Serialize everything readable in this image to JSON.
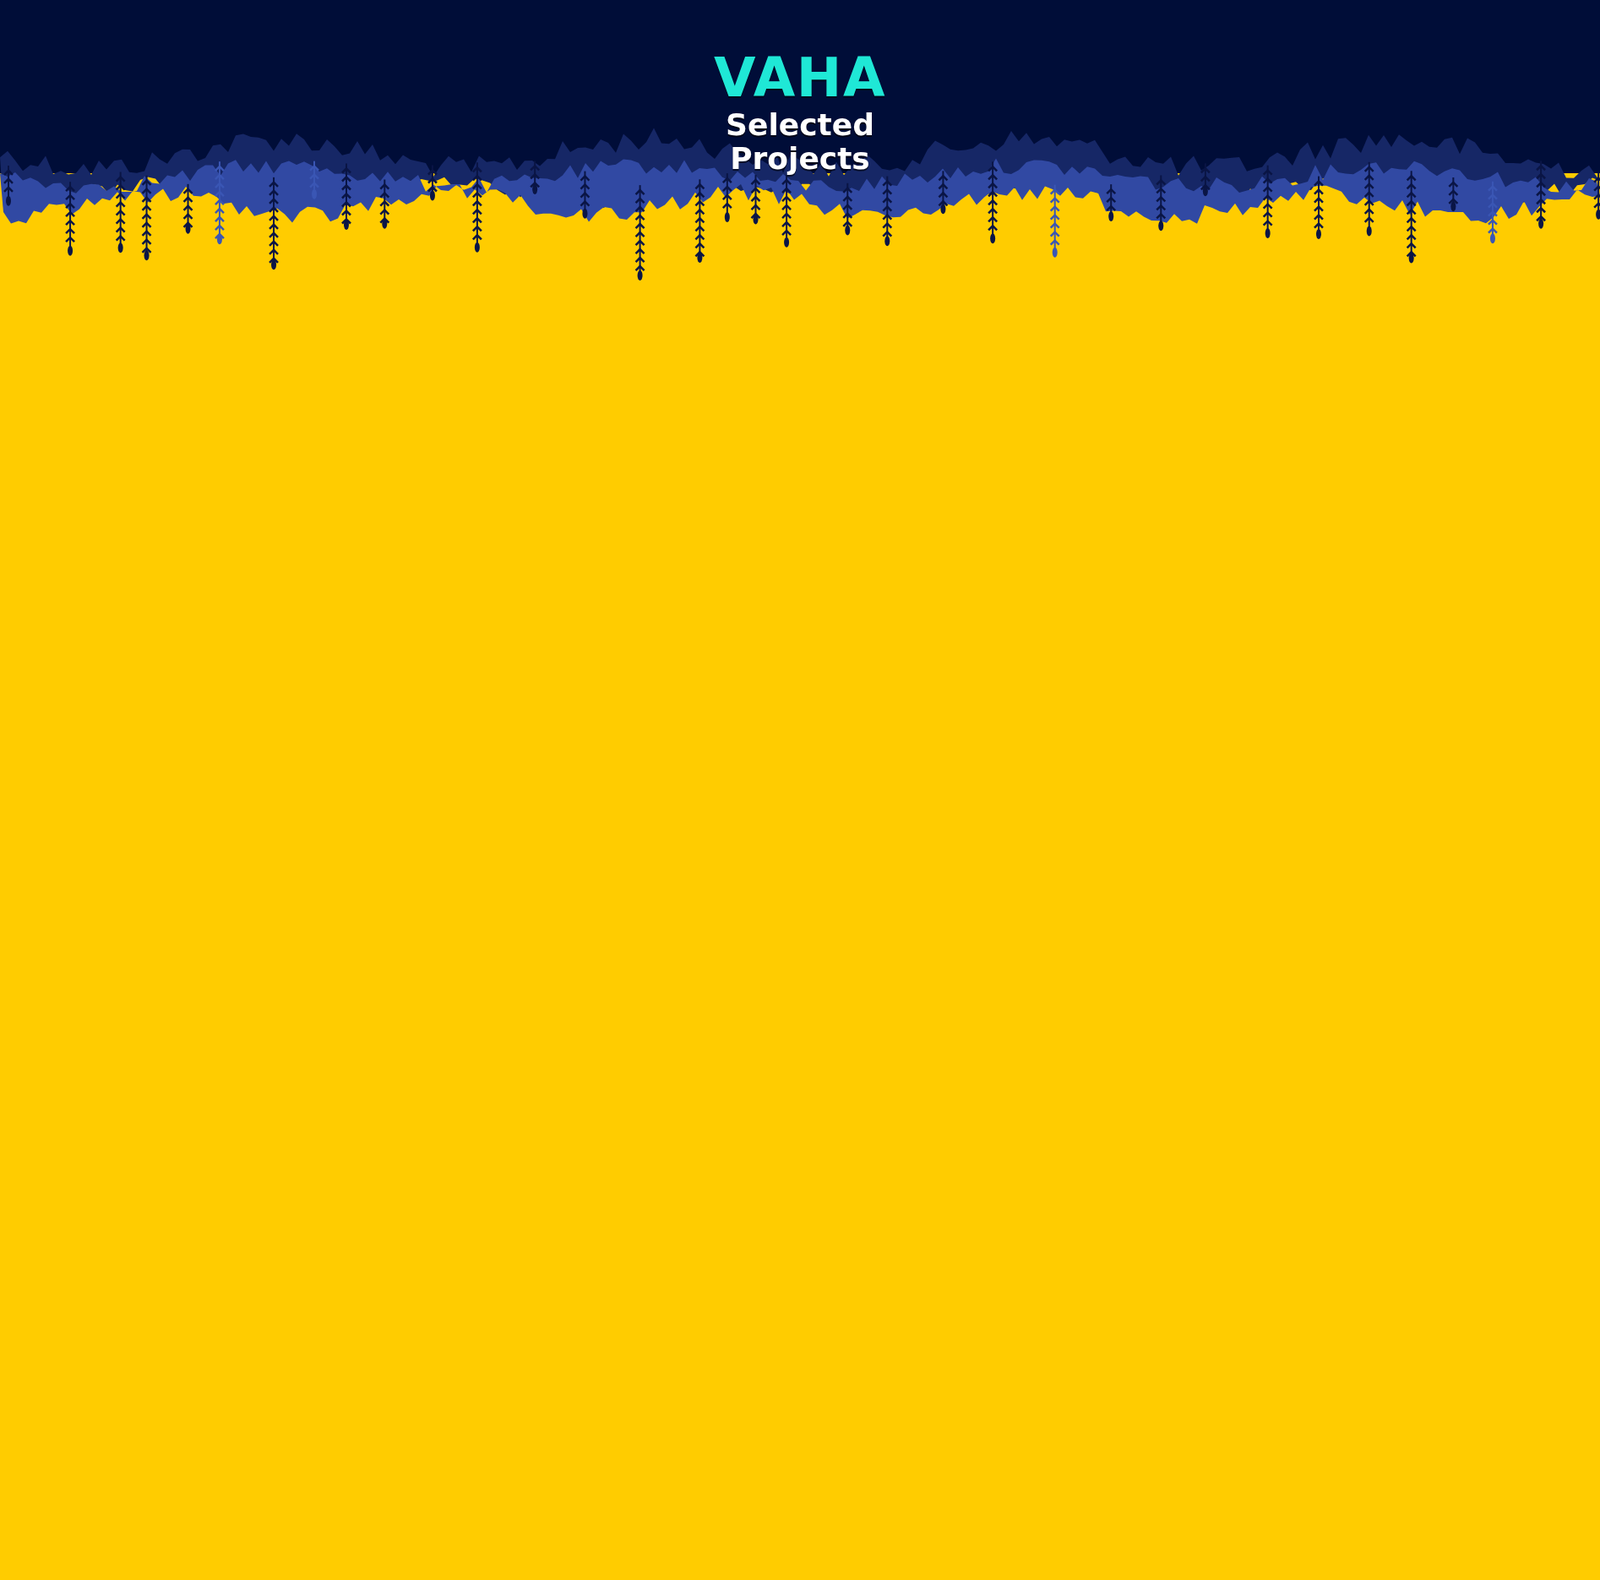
{
  "header": {
    "title": "VAHA",
    "subtitle": "Selected Projects"
  }
}
